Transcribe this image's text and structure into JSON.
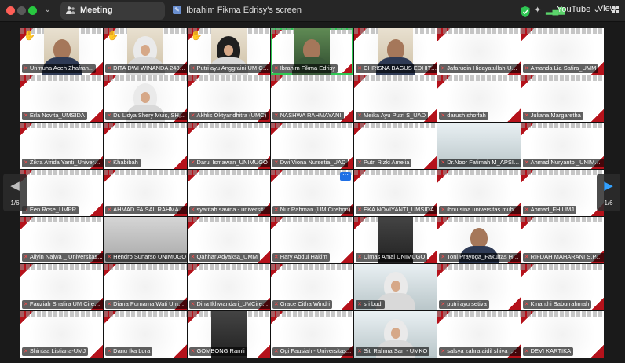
{
  "titlebar": {
    "meeting_tab": "Meeting",
    "screen_tab": "Ibrahim Fikma Edrisy's screen",
    "view_option": "YouTube",
    "view_label": "View"
  },
  "navigation": {
    "prev_page": "1/6",
    "next_page": "1/6",
    "more_options": "···"
  },
  "participants": [
    {
      "name": "Unmuha Aceh Zhafran...",
      "muted": true,
      "hand": true,
      "type": "video"
    },
    {
      "name": "DITA DWI WINANDA 24810...",
      "muted": true,
      "hand": true,
      "type": "hijab"
    },
    {
      "name": "Putri ayu Anggraini UM CIR...",
      "muted": true,
      "hand": true,
      "type": "hijab-dark"
    },
    {
      "name": "Ibrahim Fikma Edrisy",
      "muted": true,
      "hand": false,
      "type": "green",
      "active": true
    },
    {
      "name": "CHRISNA BAGUS EDHITA...",
      "muted": true,
      "hand": false,
      "type": "video"
    },
    {
      "name": "Jafarudin Hidayatullah-UM...",
      "muted": true,
      "hand": false,
      "type": "blank"
    },
    {
      "name": "Amanda Lia Safira_UMM",
      "muted": true,
      "hand": false,
      "type": "blank"
    },
    {
      "name": "Erla Novita_UMSIDA",
      "muted": true,
      "hand": false,
      "type": "blank"
    },
    {
      "name": "Dr. Lidya Shery Muis, SH,...",
      "muted": true,
      "hand": false,
      "type": "hijab-tile"
    },
    {
      "name": "Akhlis Oktyandhitra (UMC)",
      "muted": true,
      "hand": false,
      "type": "blank"
    },
    {
      "name": "NASHWA RAHMAYANI",
      "muted": true,
      "hand": false,
      "type": "blank"
    },
    {
      "name": "Meika Ayu Putri S_UAD",
      "muted": true,
      "hand": false,
      "type": "blank"
    },
    {
      "name": "darush shoffah",
      "muted": true,
      "hand": false,
      "type": "blank"
    },
    {
      "name": "Juliana Margaretha",
      "muted": true,
      "hand": false,
      "type": "blank"
    },
    {
      "name": "Zikra Afrida Yanti_Universit...",
      "muted": true,
      "hand": false,
      "type": "blank"
    },
    {
      "name": "Khabibah",
      "muted": true,
      "hand": false,
      "type": "blank"
    },
    {
      "name": "Darul Ismawan_UNIMUGO",
      "muted": true,
      "hand": false,
      "type": "blank"
    },
    {
      "name": "Dwi Viona Nursetia_UAD",
      "muted": true,
      "hand": false,
      "type": "blank"
    },
    {
      "name": "Putri Rizki Amelia",
      "muted": true,
      "hand": false,
      "type": "blank"
    },
    {
      "name": "Dr.Noor Fatimah M_APSIH...",
      "muted": true,
      "hand": false,
      "type": "room"
    },
    {
      "name": "Ahmad Nuryanto _UNIMUGO",
      "muted": true,
      "hand": false,
      "type": "blank"
    },
    {
      "name": "Een Rose_UMPR",
      "muted": true,
      "hand": false,
      "type": "blank"
    },
    {
      "name": "AHMAD FAISAL RAHMAN...",
      "muted": true,
      "hand": false,
      "type": "blank"
    },
    {
      "name": "syarifah savina - universita...",
      "muted": true,
      "hand": false,
      "type": "blank"
    },
    {
      "name": "Nur Rahman (UM Cirebon)",
      "muted": true,
      "hand": false,
      "type": "blank"
    },
    {
      "name": "EKA NOVIYANTI_UMSIDA",
      "muted": true,
      "hand": false,
      "type": "blank"
    },
    {
      "name": "ibnu sina universitas muha...",
      "muted": true,
      "hand": false,
      "type": "blank"
    },
    {
      "name": "Ahmad_FH UMJ",
      "muted": true,
      "hand": false,
      "type": "blank"
    },
    {
      "name": "Aliyin Najwa _ Universitas...",
      "muted": true,
      "hand": false,
      "type": "blank"
    },
    {
      "name": "Hendro Sunarso UNIMUGO",
      "muted": true,
      "hand": false,
      "type": "grey"
    },
    {
      "name": "Qahhar Adyaksa_UMM",
      "muted": true,
      "hand": false,
      "type": "blank"
    },
    {
      "name": "Hary Abdul Hakim",
      "muted": true,
      "hand": false,
      "type": "blank"
    },
    {
      "name": "Dimas Amal UNIMUGO",
      "muted": true,
      "hand": false,
      "type": "dark"
    },
    {
      "name": "Toni Prayoga_Fakultas Huk...",
      "muted": true,
      "hand": false,
      "type": "blank-person"
    },
    {
      "name": "RIFDAH MAHARANI S.P_UAD",
      "muted": true,
      "hand": false,
      "type": "blank"
    },
    {
      "name": "Fauziah Shafira UM Cirebon",
      "muted": true,
      "hand": false,
      "type": "blank"
    },
    {
      "name": "Diana Purnama Wati Umbb...",
      "muted": true,
      "hand": false,
      "type": "blank"
    },
    {
      "name": "Dina Ikhwandari_UMCirebon",
      "muted": true,
      "hand": false,
      "type": "blank"
    },
    {
      "name": "Grace Citha Windri",
      "muted": true,
      "hand": false,
      "type": "blank"
    },
    {
      "name": "sri budi",
      "muted": true,
      "hand": false,
      "type": "hijab-room"
    },
    {
      "name": "putri ayu setiva",
      "muted": true,
      "hand": false,
      "type": "blank"
    },
    {
      "name": "Kinanthi Baburrahmah",
      "muted": true,
      "hand": false,
      "type": "blank"
    },
    {
      "name": "Shintaa Listiana-UMJ",
      "muted": true,
      "hand": false,
      "type": "blank"
    },
    {
      "name": "Danu Ika Lora",
      "muted": true,
      "hand": false,
      "type": "blank"
    },
    {
      "name": "GOMBONG Ramli",
      "muted": true,
      "hand": false,
      "type": "room-dark"
    },
    {
      "name": "Ogi Fausiah - Universitas...",
      "muted": true,
      "hand": false,
      "type": "blank"
    },
    {
      "name": "Siti Rahma Sari - UMKO",
      "muted": true,
      "hand": false,
      "type": "hijab-room"
    },
    {
      "name": "salsya zahra aidil shiva_UAD",
      "muted": true,
      "hand": false,
      "type": "blank"
    },
    {
      "name": "DEVI KARTIKA",
      "muted": true,
      "hand": false,
      "type": "blank"
    }
  ]
}
